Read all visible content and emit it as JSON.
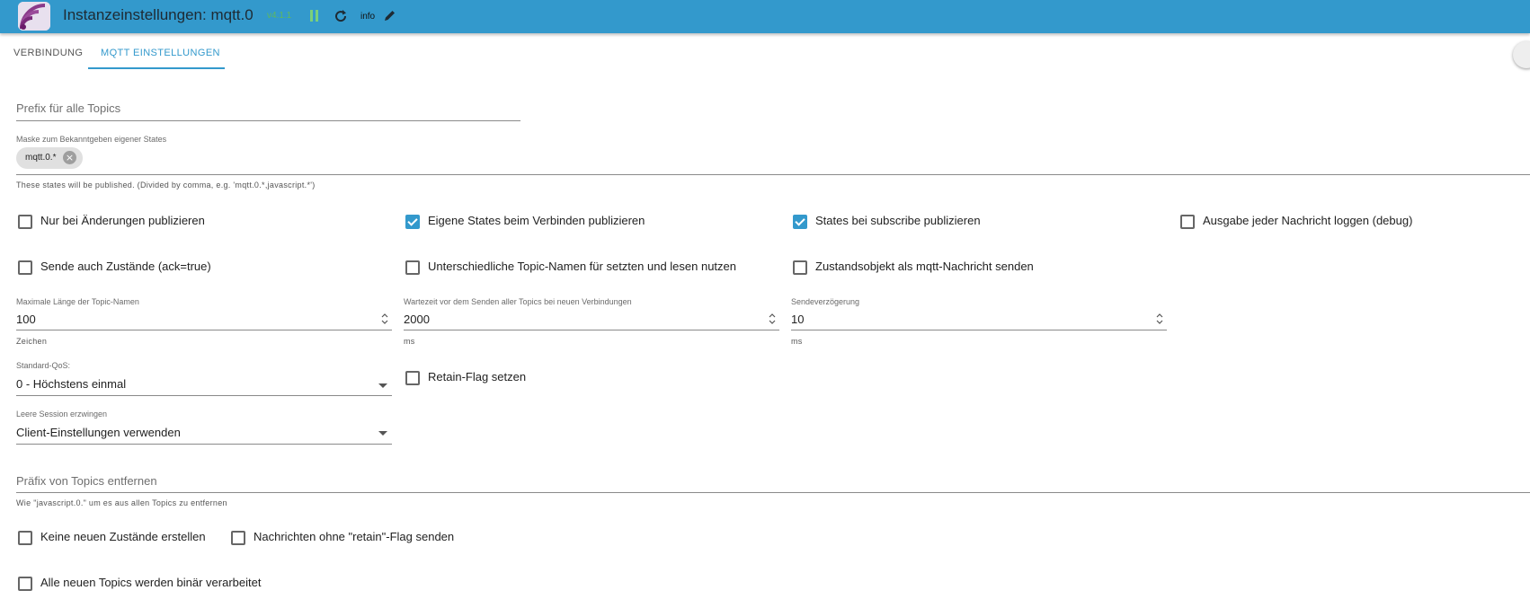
{
  "header": {
    "title": "Instanzeinstellungen: mqtt.0",
    "version": "v4.1.1",
    "info_label": "info"
  },
  "tabs": [
    {
      "label": "VERBINDUNG",
      "active": false
    },
    {
      "label": "MQTT EINSTELLUNGEN",
      "active": true
    }
  ],
  "prefix_field": {
    "placeholder": "Prefix für alle Topics",
    "value": ""
  },
  "mask_field": {
    "label": "Maske zum Bekanntgeben eigener States",
    "chip": "mqtt.0.*",
    "helper": "These states will be published. (Divided by comma, e.g. 'mqtt.0.*,javascript.*')"
  },
  "checkboxes_row1": [
    {
      "label": "Nur bei Änderungen publizieren",
      "checked": false
    },
    {
      "label": "Eigene States beim Verbinden publizieren",
      "checked": true
    },
    {
      "label": "States bei subscribe publizieren",
      "checked": true
    },
    {
      "label": "Ausgabe jeder Nachricht loggen (debug)",
      "checked": false
    }
  ],
  "checkboxes_row2": [
    {
      "label": "Sende auch Zustände (ack=true)",
      "checked": false
    },
    {
      "label": "Unterschiedliche Topic-Namen für setzten und lesen nutzen",
      "checked": false
    },
    {
      "label": "Zustandsobjekt als mqtt-Nachricht senden",
      "checked": false
    }
  ],
  "numbers": [
    {
      "label": "Maximale Länge der Topic-Namen",
      "value": "100",
      "unit": "Zeichen"
    },
    {
      "label": "Wartezeit vor dem Senden aller Topics bei neuen Verbindungen",
      "value": "2000",
      "unit": "ms"
    },
    {
      "label": "Sendeverzögerung",
      "value": "10",
      "unit": "ms"
    }
  ],
  "qos_select": {
    "label": "Standard-QoS:",
    "value": "0 - Höchstens einmal"
  },
  "retain_checkbox": {
    "label": "Retain-Flag setzen",
    "checked": false
  },
  "session_select": {
    "label": "Leere Session erzwingen",
    "value": "Client-Einstellungen verwenden"
  },
  "remove_prefix_field": {
    "placeholder": "Präfix von Topics entfernen",
    "helper": "Wie \"javascript.0.\" um es aus allen Topics zu entfernen"
  },
  "checkboxes_bottom": [
    {
      "label": "Keine neuen Zustände erstellen",
      "checked": false
    },
    {
      "label": "Nachrichten ohne \"retain\"-Flag senden",
      "checked": false
    },
    {
      "label": "Alle neuen Topics werden binär verarbeitet",
      "checked": false
    }
  ],
  "colors": {
    "accent": "#3399cc",
    "header_bg": "#3399cc",
    "version_green": "#5fb85f"
  },
  "icons": [
    "app-logo-icon",
    "pause-icon",
    "reload-icon",
    "edit-icon",
    "chip-remove-icon",
    "dropdown-arrow-icon",
    "spinner-icon",
    "scroll-top-icon"
  ]
}
